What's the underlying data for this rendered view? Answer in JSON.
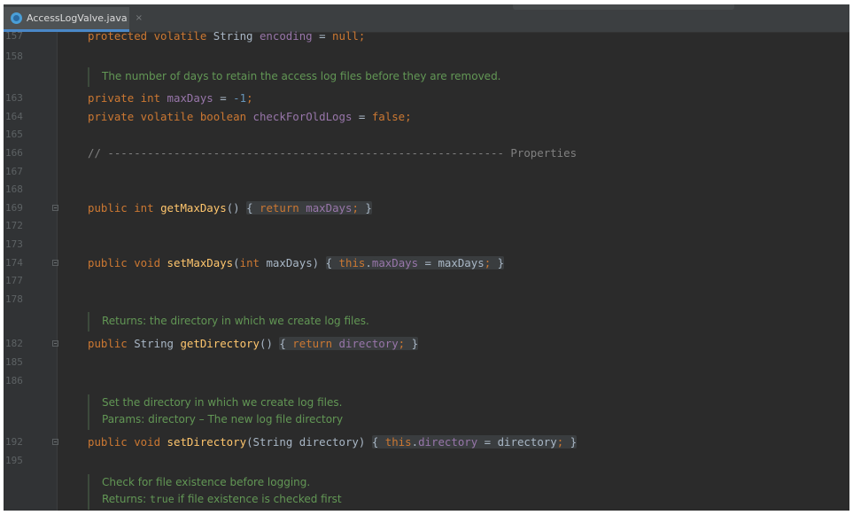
{
  "tab": {
    "filename": "AccessLogValve.java",
    "close_glyph": "×",
    "icon": "java-class-icon"
  },
  "colors": {
    "editor_bg": "#2b2b2b",
    "keyword": "#cc7832",
    "field": "#9876aa",
    "method": "#ffc66d",
    "number": "#6897bb",
    "doc_comment": "#629755",
    "line_comment": "#808080",
    "text": "#a9b7c6"
  },
  "lines": [
    {
      "num": "157"
    },
    {
      "num": "158"
    },
    {
      "num": "163"
    },
    {
      "num": "164"
    },
    {
      "num": "165"
    },
    {
      "num": "166"
    },
    {
      "num": "167"
    },
    {
      "num": "168"
    },
    {
      "num": "169"
    },
    {
      "num": "172"
    },
    {
      "num": "173"
    },
    {
      "num": "174"
    },
    {
      "num": "177"
    },
    {
      "num": "178"
    },
    {
      "num": "182"
    },
    {
      "num": "185"
    },
    {
      "num": "186"
    },
    {
      "num": "192"
    },
    {
      "num": "195"
    }
  ],
  "code": {
    "l157": {
      "kw1": "protected volatile",
      "type": " String ",
      "field": "encoding",
      "op": " = ",
      "kw2": "null",
      "end": ";"
    },
    "l163": {
      "kw1": "private int",
      "sp": " ",
      "field": "maxDays",
      "op": " = ",
      "num": "-1",
      "end": ";"
    },
    "l164": {
      "kw1": "private volatile boolean",
      "sp": " ",
      "field": "checkForOldLogs",
      "op": " = ",
      "kw2": "false",
      "end": ";"
    },
    "l166": {
      "comment": "// ------------------------------------------------------------ Properties"
    },
    "l169": {
      "kw1": "public int",
      "sp": " ",
      "method": "getMaxDays",
      "paren": "() ",
      "open": "{",
      "kw2": " return ",
      "field": "maxDays",
      "semi": "; ",
      "close": "}"
    },
    "l174": {
      "kw1": "public void",
      "sp": " ",
      "method": "setMaxDays",
      "p1": "(",
      "kw2": "int",
      "p2": " maxDays) ",
      "open": "{",
      "kw3": " this",
      "dot": ".",
      "field": "maxDays",
      "rest": " = maxDays",
      "semi": "; ",
      "close": "}"
    },
    "l182": {
      "kw1": "public",
      "type": " String ",
      "method": "getDirectory",
      "paren": "() ",
      "open": "{",
      "kw2": " return ",
      "field": "directory",
      "semi": "; ",
      "close": "}"
    },
    "l192": {
      "kw1": "public void",
      "sp": " ",
      "method": "setDirectory",
      "params": "(String directory) ",
      "open": "{",
      "kw2": " this",
      "dot": ".",
      "field": "directory",
      "rest": " = directory",
      "semi": "; ",
      "close": "}"
    }
  },
  "docs": {
    "d1": "The number of days to retain the access log files before they are removed.",
    "d2": "Returns: the directory in which we create log files.",
    "d3a": "Set the directory in which we create log files.",
    "d3b": "Params: directory – The new log file directory",
    "d4a": "Check for file existence before logging.",
    "d4b_prefix": "Returns: ",
    "d4b_code": "true",
    "d4b_suffix": " if file existence is checked first"
  }
}
